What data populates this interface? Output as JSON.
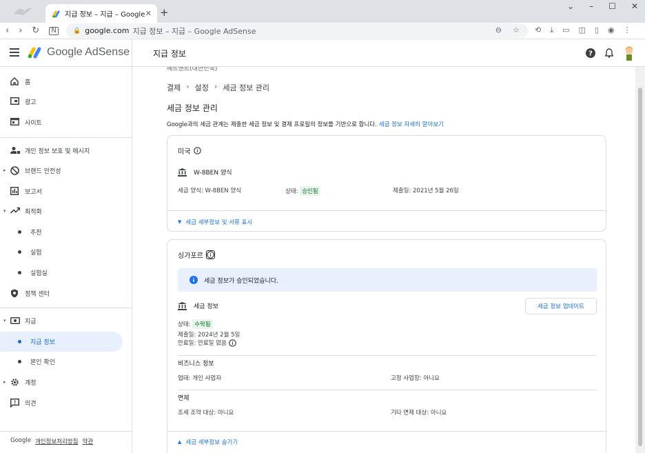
{
  "browser": {
    "tab_title": "지급 정보 – 지급 – Google AdSe",
    "url_host": "google.com",
    "url_title": "지급 정보 – 지급 – Google AdSense"
  },
  "header": {
    "product": "Google AdSense",
    "page_title": "지급 정보"
  },
  "sidebar": {
    "items": [
      {
        "label": "홈",
        "icon": "home-icon"
      },
      {
        "label": "광고",
        "icon": "ads-icon"
      },
      {
        "label": "사이트",
        "icon": "sites-icon"
      },
      {
        "label": "개인 정보 보호 및 메시지",
        "icon": "privacy-icon"
      },
      {
        "label": "브랜드 안전성",
        "icon": "block-icon"
      },
      {
        "label": "보고서",
        "icon": "reports-icon"
      },
      {
        "label": "최적화",
        "icon": "trending-icon"
      },
      {
        "label": "추천"
      },
      {
        "label": "실험"
      },
      {
        "label": "실험실"
      },
      {
        "label": "정책 센터",
        "icon": "policy-icon"
      },
      {
        "label": "지급",
        "icon": "payments-icon"
      },
      {
        "label": "지급 정보"
      },
      {
        "label": "본인 확인"
      },
      {
        "label": "계정",
        "icon": "gear-icon"
      },
      {
        "label": "의견",
        "icon": "feedback-icon"
      }
    ],
    "footer": {
      "brand": "Google",
      "privacy": "개인정보처리방침",
      "terms": "약관"
    }
  },
  "main": {
    "cut_text": "메트앤트(대한민국)",
    "breadcrumbs": [
      "결제",
      "설정",
      "세금 정보 관리"
    ],
    "title": "세금 정보 관리",
    "description": "Google과의 세금 관계는 제출한 세금 정보 및 결제 프로필의 정보를 기반으로 합니다.",
    "learn_more": "세금 정보 자세히 알아보기",
    "us": {
      "country": "미국",
      "form": "W-8BEN 양식",
      "tax_form_label": "세금 양식: W-8BEN 양식",
      "status_label": "상태:",
      "status_value": "승인됨",
      "submitted": "제출일: 2021년 5월 26일",
      "toggle": "세금 세부정보 및 서류 표시"
    },
    "sg": {
      "country": "싱가포르",
      "info_msg": "세금 정보가 승인되었습니다.",
      "tax_info": "세금 정보",
      "update_button": "세금 정보 업데이트",
      "status_label": "상태:",
      "status_value": "수락됨",
      "submitted": "제출일: 2024년 2월 5일",
      "expiry": "만료일: 만료일 없음",
      "business_head": "비즈니스 정보",
      "business_type": "업태: 개인 사업자",
      "fixed_place": "고정 사업장: 아니요",
      "exempt_head": "면제",
      "treaty": "조세 조약 대상: 아니요",
      "other_exempt": "기타 면제 대상: 아니요",
      "toggle": "세금 세부정보 숨기기"
    }
  },
  "colors": {
    "accent": "#1a73e8",
    "active_bg": "#e8f0fe",
    "success_bg": "#e6f4ea",
    "success_text": "#137333"
  }
}
